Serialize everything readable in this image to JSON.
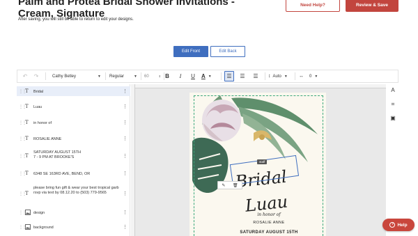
{
  "header": {
    "title": "Palm and Protea Bridal Shower Invitations - Cream, Signature",
    "subtitle": "After saving, you will still be able to return to edit your designs.",
    "help_label": "Need Help?",
    "review_label": "Review & Save"
  },
  "tabs": {
    "front_label": "Edit Front",
    "back_label": "Edit Back",
    "active": "front"
  },
  "toolbar": {
    "font_family": "Cathy Betley",
    "font_weight": "Regular",
    "font_size": "60",
    "bold": "B",
    "italic": "I",
    "underline": "U",
    "text_color_letter": "A",
    "line_height": "Auto",
    "letter_spacing": "0",
    "active_alignment": "left",
    "icons": [
      "undo-icon",
      "redo-icon",
      "align-left-icon",
      "align-center-icon",
      "align-right-icon",
      "line-height-icon",
      "letter-spacing-icon"
    ]
  },
  "layers": {
    "selected_index": 0,
    "items": [
      {
        "type": "T",
        "label": "Bridal"
      },
      {
        "type": "T",
        "label": "Luau"
      },
      {
        "type": "T",
        "label": "in honor of"
      },
      {
        "type": "T",
        "label": "ROSALIE ANNE"
      },
      {
        "type": "T",
        "label": "SATURDAY AUGUST 15TH\n7 - 9 PM AT BROOKE'S"
      },
      {
        "type": "T",
        "label": "6348 SE 163RD AVE, BEND, OR"
      },
      {
        "type": "T",
        "label": "please bring fun gift & wear your best tropical garb\nrsvp via text by 08.12.20 to (503) 779-9565"
      },
      {
        "type": "image",
        "label": "design"
      },
      {
        "type": "image",
        "label": "background"
      }
    ]
  },
  "canvas": {
    "staff_tag": "staff",
    "text_bridal": "Bridal",
    "text_luau": "Luau",
    "text_inhonor": "in honor of",
    "text_rosalie": "ROSALIE ANNE",
    "text_date": "SATURDAY AUGUST 15TH",
    "guide_color": "#3aa87a",
    "card_color": "#fbf8ef"
  },
  "right_rail": {
    "icons": [
      "text-tool-icon",
      "crop-icon",
      "image-tool-icon"
    ],
    "text_tool_letter": "A"
  },
  "help_pill": {
    "label": "Help",
    "color": "#c9463c"
  },
  "colors": {
    "accent": "#3f6ebf",
    "brand": "#c2453e"
  }
}
